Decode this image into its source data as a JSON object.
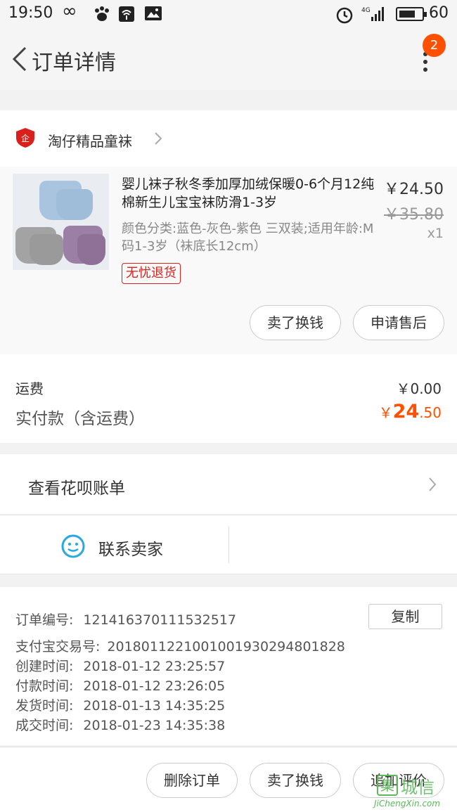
{
  "status_bar": {
    "time": "19:50",
    "icons": [
      "infinity-icon",
      "baidu-paw-icon",
      "wifi-box-icon",
      "image-notification-icon",
      "alarm-icon",
      "4g-signal-icon",
      "battery-icon"
    ],
    "network": "4G",
    "battery": "60"
  },
  "nav": {
    "title": "订单详情",
    "badge_count": "2"
  },
  "shop": {
    "name": "淘仔精品童袜"
  },
  "product": {
    "title": "婴儿袜子秋冬季加厚加绒保暖0-6个月12纯棉新生儿宝宝袜防滑1-3岁",
    "spec": "颜色分类:蓝色-灰色-紫色 三双装;适用年龄:M码1-3岁（袜底长12cm）",
    "tag": "无忧退货",
    "price": "￥24.50",
    "original_price": "￥35.80",
    "quantity": "x1",
    "buttons": {
      "resell": "卖了换钱",
      "after_sale": "申请售后"
    }
  },
  "fees": {
    "shipping_label": "运费",
    "shipping_value": "￥0.00",
    "paid_label": "实付款（含运费）",
    "paid_currency": "￥",
    "paid_integer": "24",
    "paid_decimal": ".50"
  },
  "huabei": {
    "label": "查看花呗账单"
  },
  "contact": {
    "label": "联系卖家"
  },
  "order_info": {
    "copy_label": "复制",
    "rows": [
      {
        "label": "订单编号:",
        "value": "121416370111532517"
      },
      {
        "label": "支付宝交易号:",
        "value": "2018011221001001930294801828"
      },
      {
        "label": "创建时间:",
        "value": "2018-01-12 23:25:57"
      },
      {
        "label": "付款时间:",
        "value": "2018-01-12 23:26:05"
      },
      {
        "label": "发货时间:",
        "value": "2018-01-13 14:35:25"
      },
      {
        "label": "成交时间:",
        "value": "2018-01-23 14:35:38"
      }
    ]
  },
  "bottom_bar": {
    "delete_order": "删除订单",
    "resell": "卖了换钱",
    "add_review": "追加评价"
  },
  "watermark": {
    "text": "城信",
    "url": "JiChengXin.com"
  },
  "colors": {
    "accent_orange": "#ff5000",
    "tag_red": "#d9201a",
    "contact_blue": "#2aa8e0"
  }
}
